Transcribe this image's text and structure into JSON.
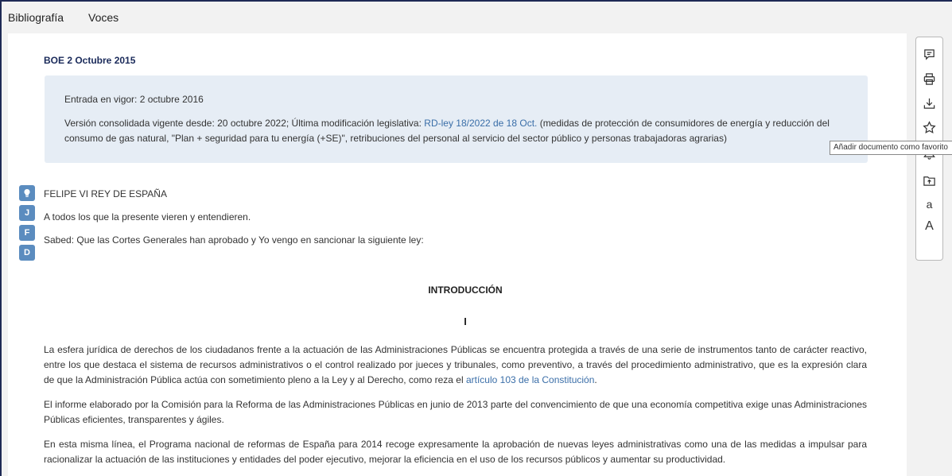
{
  "topnav": {
    "items": [
      "Bibliografía",
      "Voces"
    ]
  },
  "document": {
    "header": "BOE 2 Octubre 2015",
    "info": {
      "entrada_vigor": "Entrada en vigor: 2 octubre 2016",
      "version_prefix": "Versión consolidada vigente desde: 20 octubre 2022; Última modificación legislativa: ",
      "version_link": "RD-ley 18/2022 de 18 Oct.",
      "version_suffix": " (medidas de protección de consumidores de energía y reducción del consumo de gas natural, \"Plan + seguridad para tu energía (+SE)\", retribuciones del personal al servicio del sector público y personas trabajadoras agrarias)"
    },
    "badges": [
      "J",
      "F",
      "D"
    ],
    "intro_lines": [
      "FELIPE VI REY DE ESPAÑA",
      "A todos los que la presente vieren y entendieren.",
      "Sabed: Que las Cortes Generales han aprobado y Yo vengo en sancionar la siguiente ley:"
    ],
    "heading": "INTRODUCCIÓN",
    "section_roman": "I",
    "para1_prefix": "La esfera jurídica de derechos de los ciudadanos frente a la actuación de las Administraciones Públicas se encuentra protegida a través de una serie de instrumentos tanto de carácter reactivo, entre los que destaca el sistema de recursos administrativos o el control realizado por jueces y tribunales, como preventivo, a través del procedimiento administrativo, que es la expresión clara de que la Administración Pública actúa con sometimiento pleno a la Ley y al Derecho, como reza el ",
    "para1_link": "artículo 103 de la Constitución",
    "para1_suffix": ".",
    "para2": "El informe elaborado por la Comisión para la Reforma de las Administraciones Públicas en junio de 2013 parte del convencimiento de que una economía competitiva exige unas Administraciones Públicas eficientes, transparentes y ágiles.",
    "para3": "En esta misma línea, el Programa nacional de reformas de España para 2014 recoge expresamente la aprobación de nuevas leyes administrativas como una de las medidas a impulsar para racionalizar la actuación de las instituciones y entidades del poder ejecutivo, mejorar la eficiencia en el uso de los recursos públicos y aumentar su productividad."
  },
  "toolbar": {
    "icons": [
      "comment-icon",
      "print-icon",
      "download-icon",
      "star-icon",
      "bell-icon",
      "folder-upload-icon",
      "font-decrease-icon",
      "font-increase-icon"
    ],
    "font_small": "a",
    "font_large": "A",
    "tooltip": "Añadir documento como favorito"
  },
  "colors": {
    "accent": "#5b8cbf",
    "link": "#3a6ea8",
    "infobox": "#e6edf5",
    "frame": "#1e2a55"
  }
}
